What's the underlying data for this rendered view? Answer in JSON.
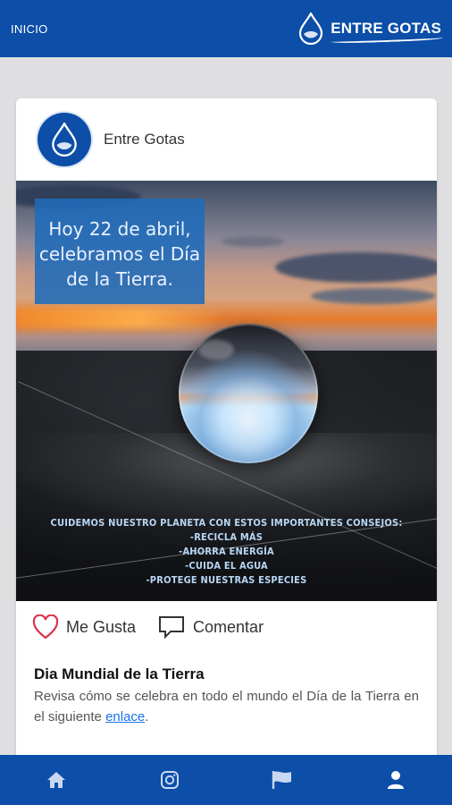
{
  "header": {
    "home_label": "INICIO",
    "brand_name": "ENTRE GOTAS"
  },
  "post": {
    "author": "Entre Gotas",
    "image_overlay_text": "Hoy 22 de abril, celebramos el Día de la Tierra.",
    "image_tips_heading": "CUIDEMOS NUESTRO PLANETA CON ESTOS IMPORTANTES CONSEJOS:",
    "image_tips": [
      "-RECICLA MÁS",
      "-AHORRA ENERGÍA",
      "-CUIDA EL AGUA",
      "-PROTEGE NUESTRAS ESPECIES"
    ],
    "like_label": "Me Gusta",
    "comment_label": "Comentar",
    "title": "Dia Mundial de la Tierra",
    "text_before_link": "Revisa cómo se celebra en todo el mundo el Día de la Tierra en el siguiente ",
    "link_label": "enlace",
    "text_after_link": "."
  },
  "bottom_nav": {
    "items": [
      "home-icon",
      "instagram-icon",
      "flag-icon",
      "user-icon"
    ]
  },
  "colors": {
    "primary": "#0c4ea8",
    "background": "#dfdfe1",
    "like": "#d9344a",
    "link": "#1a73e8"
  }
}
